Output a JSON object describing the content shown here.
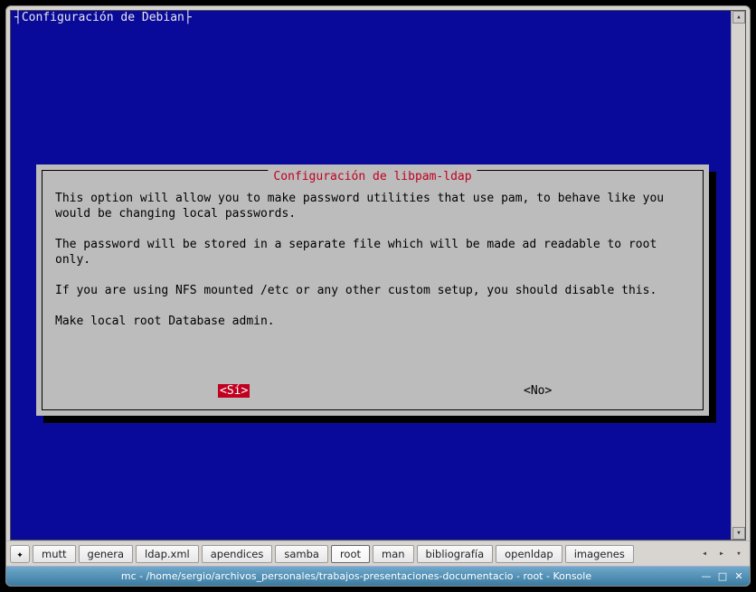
{
  "tui": {
    "header_title": "Configuración de Debian",
    "dialog": {
      "title": " Configuración de libpam-ldap ",
      "para1": "This option will allow you to make password utilities that use pam, to behave like you would be changing local passwords.",
      "para2": "The password will be stored in a separate file which will be made ad readable to root only.",
      "para3": "If you are using NFS mounted /etc or any other custom setup, you should disable this.",
      "para4": "Make local root Database admin.",
      "yes_label": "<Sí>",
      "no_label": "<No>"
    }
  },
  "tabs": {
    "items": [
      {
        "label": "mutt"
      },
      {
        "label": "genera"
      },
      {
        "label": "ldap.xml"
      },
      {
        "label": "apendices"
      },
      {
        "label": "samba"
      },
      {
        "label": "root"
      },
      {
        "label": "man"
      },
      {
        "label": "bibliografía"
      },
      {
        "label": "openldap"
      },
      {
        "label": "imagenes"
      }
    ],
    "active_index": 5
  },
  "window": {
    "title": "mc - /home/sergio/archivos_personales/trabajos-presentaciones-documentacio - root - Konsole"
  },
  "colors": {
    "terminal_bg": "#0a0a9a",
    "dialog_bg": "#bcbcbc",
    "accent_red": "#c00020",
    "titlebar_gradient_top": "#6fa9cc",
    "titlebar_gradient_bottom": "#3a7aa0"
  }
}
